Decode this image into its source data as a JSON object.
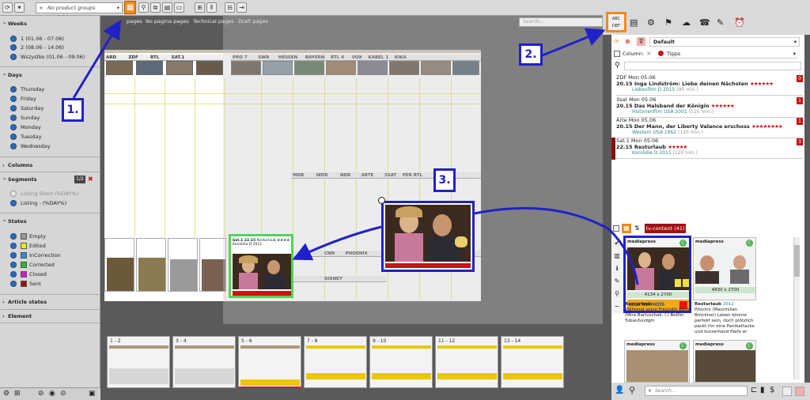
{
  "toolbar": {
    "product_groups": "No product groups available...",
    "search_placeholder": "Search..."
  },
  "sidebar": {
    "weeks_title": "Weeks",
    "weeks": [
      "1 (01.06 - 07.06)",
      "2 (08.06 - 14.06)",
      "Wszystko (01.06 - 09.06)"
    ],
    "days_title": "Days",
    "days": [
      "Thursday",
      "Friday",
      "Saturday",
      "Sunday",
      "Monday",
      "Tuesday",
      "Wednesday"
    ],
    "columns_title": "Columns",
    "segments_title": "Segments",
    "segments_count": "1/2",
    "segments": [
      "Listing Short (%DAY%)",
      "Listing - (%DAY%)"
    ],
    "states_title": "States",
    "states": [
      {
        "label": "Empty",
        "color": "#9a9a9a"
      },
      {
        "label": "Edited",
        "color": "#e8e81a"
      },
      {
        "label": "InCorrection",
        "color": "#2a8fd8"
      },
      {
        "label": "Corrected",
        "color": "#2eb82e"
      },
      {
        "label": "Closed",
        "color": "#c81ec8"
      },
      {
        "label": "Sent",
        "color": "#9a1010"
      }
    ],
    "article_states_title": "Article states",
    "element_title": "Element"
  },
  "tabs": [
    "pages",
    "No pagina pages",
    "Technical pages",
    "Draft pages"
  ],
  "page_channels_top": [
    "ARD",
    "ZDF",
    "RTL",
    "SAT.1",
    "PRO 7",
    "SWR",
    "HESSEN",
    "BAYERN",
    "RTL II",
    "VOX",
    "KABEL 1",
    "KIKA"
  ],
  "page_channels_mid": [
    "MDR",
    "WDR",
    "NDR",
    "ARTE",
    "3SAT",
    "PER RTL"
  ],
  "page_channels_low": [
    "CNN",
    "PHOENIX"
  ],
  "page_channels_disney": "DISNEY",
  "bottom_pages": [
    "1 - 2",
    "3 - 4",
    "5 - 6",
    "7 - 8",
    "9 - 10",
    "11 - 12",
    "13 - 14"
  ],
  "right_panel": {
    "style_name": "Default",
    "column_label": "Column:",
    "column_value": "Tipps",
    "programs": [
      {
        "line1": "ZDF  Mon 05.06",
        "time": "20.15",
        "title": "Inga Lindström: Liebe deinen Nächsten",
        "stars": "★★★★★★",
        "meta": "Liebesfilm D 2015",
        "dur": "(90 min.)",
        "badge": "0"
      },
      {
        "line1": "3sat  Mon 05.06",
        "time": "20.15",
        "title": "Das Halsband der Königin",
        "stars": "★★★★★★",
        "meta": "Historienfilm USA 2001",
        "dur": "(115 min.)",
        "badge": "1"
      },
      {
        "line1": "Arte  Mon 05.06",
        "time": "20.15",
        "title": "Der Mann, der Liberty Valance erschoss",
        "stars": "★★★★★★★★",
        "meta": "Western USA 1962",
        "dur": "(120 min.)",
        "badge": "1"
      },
      {
        "line1": "Sat.1  Mon 05.06",
        "time": "22.15",
        "title": "Resturlaub",
        "stars": "★★★★★",
        "meta": "Komödie D 2011",
        "dur": "(120 min.)",
        "badge": "3"
      }
    ],
    "content_tab": "tv-content (41)",
    "cards": [
      {
        "source": "mediapress",
        "dims": "4134 x 2700",
        "selected": "SELECTED PHOTO"
      },
      {
        "source": "mediapress",
        "dims": "4830 x 2700"
      }
    ],
    "card_texts": [
      {
        "title": "Resturlaub",
        "year": "2011",
        "body": "Während seine Freundin Biene (Mira Bartuschek, l.) Beißin Tubaufundgm"
      },
      {
        "title": "Resturlaub",
        "year": "2011",
        "body": "Pitschis (Maximilian Brückner) Leben könnte perfekt sein, doch plötzlich packt ihn eine Panikattacke und kurzerhand flieht er"
      }
    ],
    "bottom_search_placeholder": "Search..."
  },
  "annotations": [
    "1.",
    "2.",
    "3."
  ],
  "colors": {
    "accent": "#f08a1c",
    "callout": "#2121c8",
    "selected_green": "#53d453",
    "red": "#c81414"
  }
}
